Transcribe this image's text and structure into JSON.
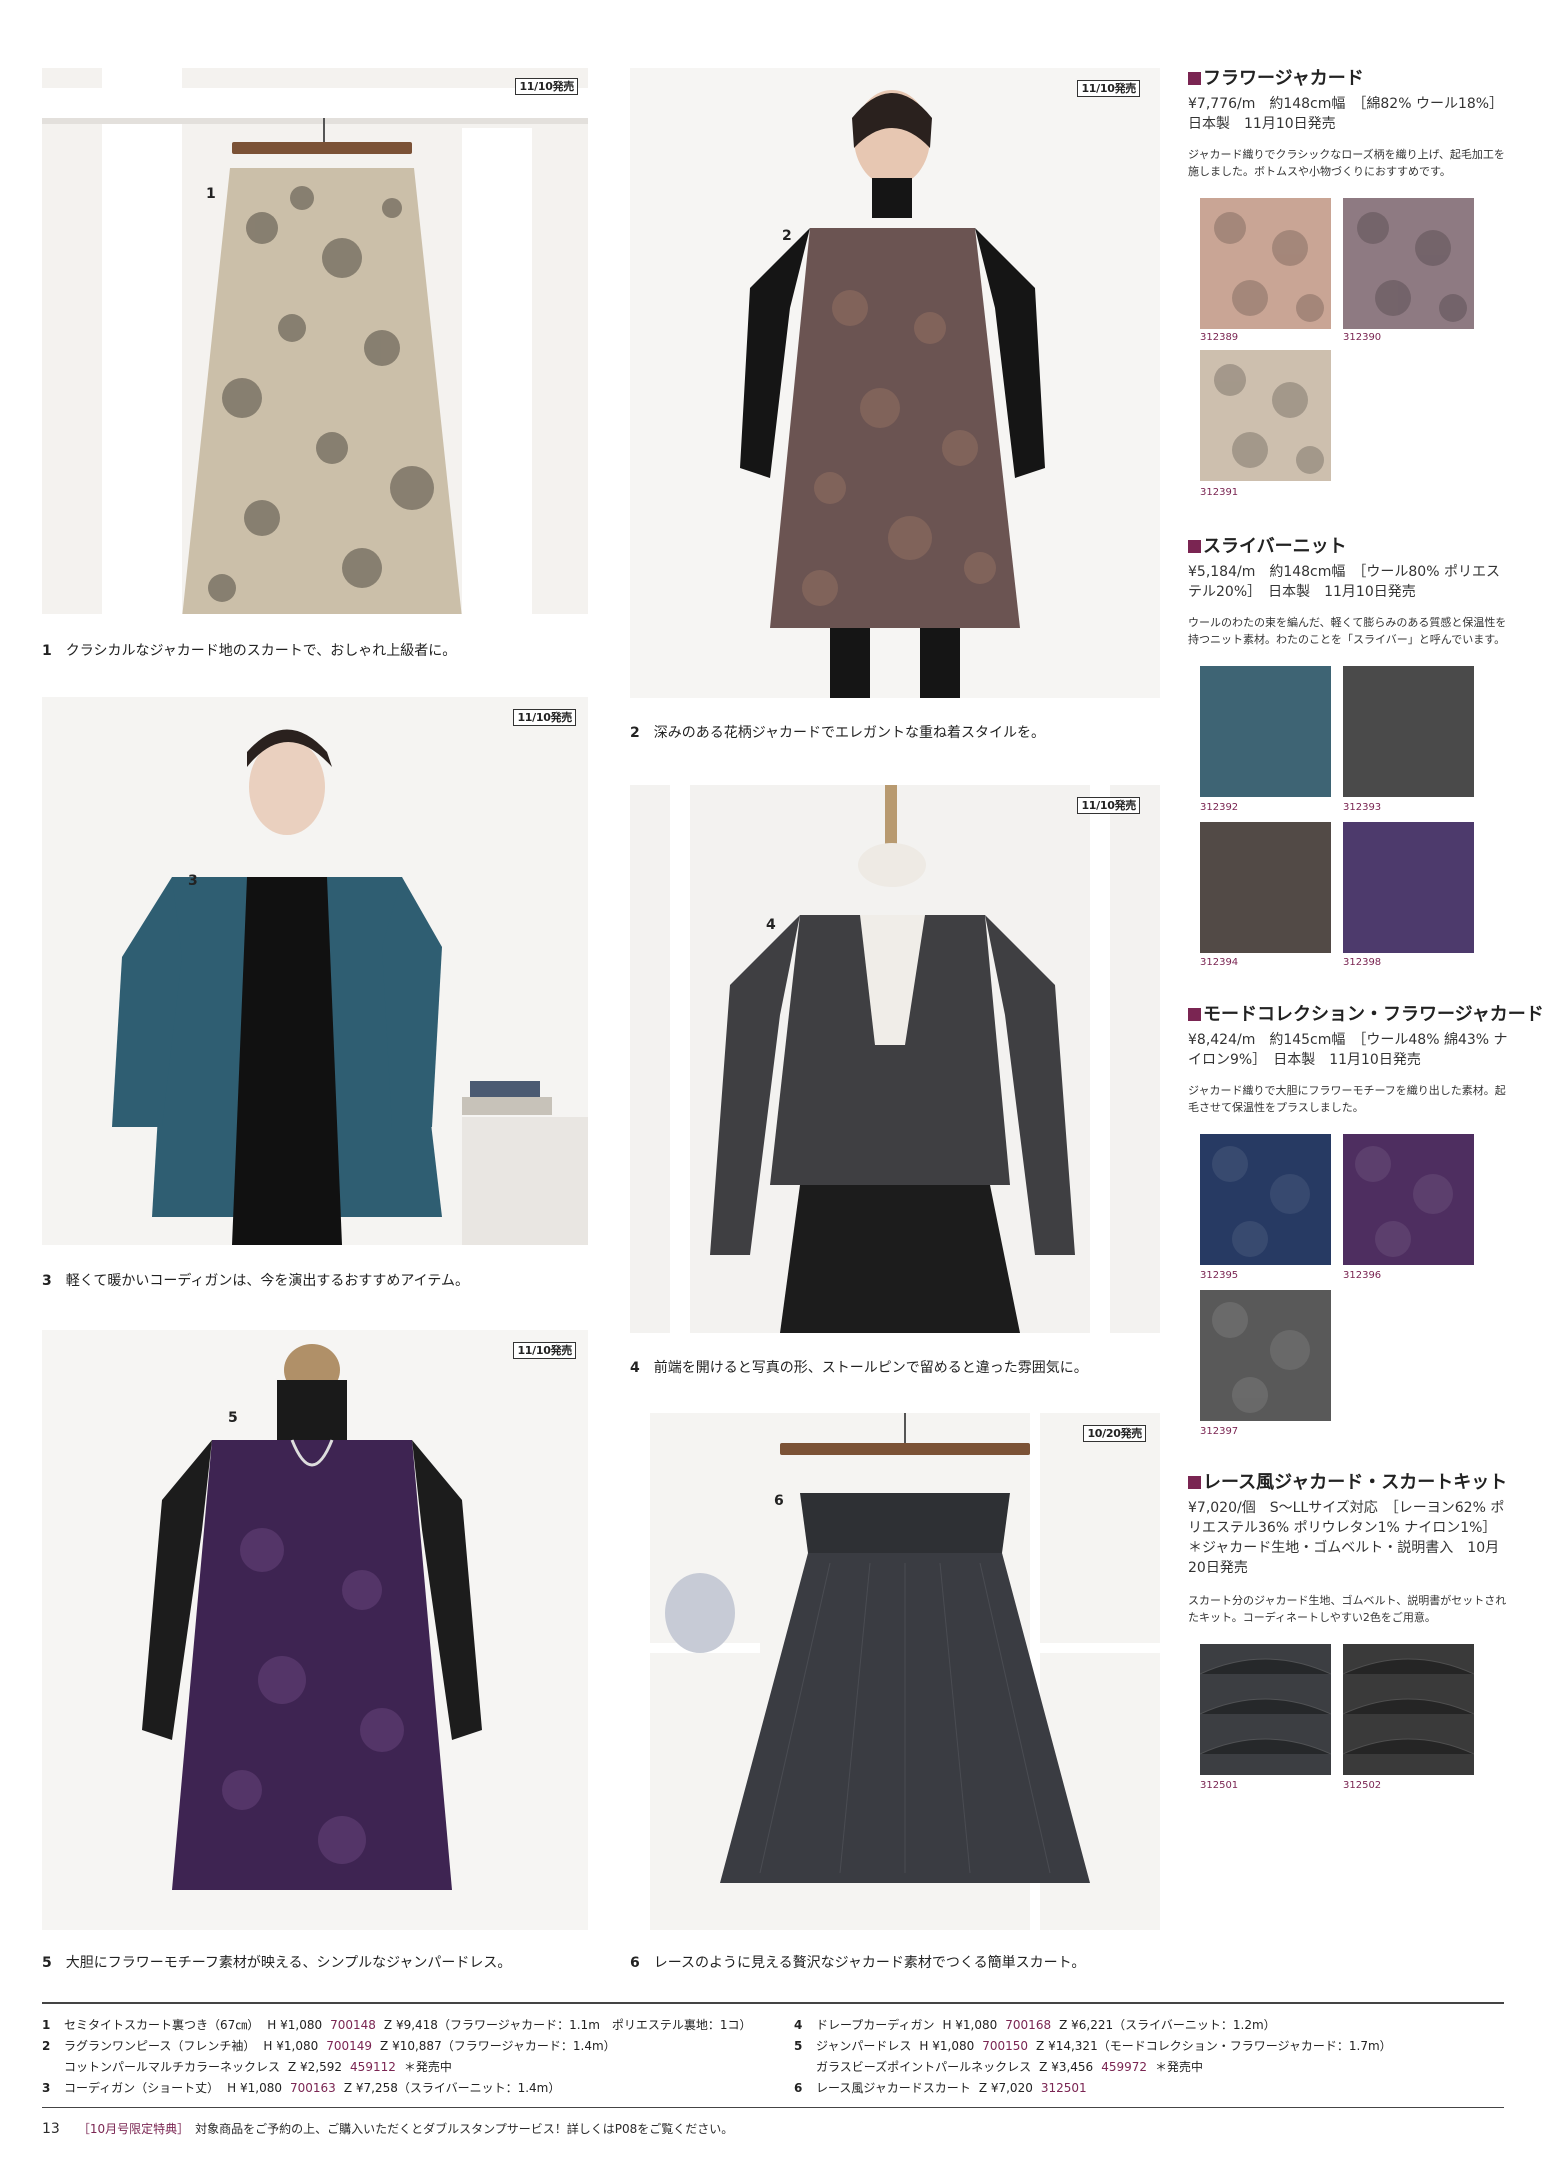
{
  "photos": [
    {
      "tag": "11/10発売",
      "num": "1",
      "caption_num": "1",
      "caption": "クラシカルなジャカード地のスカートで、おしゃれ上級者に。"
    },
    {
      "tag": "11/10発売",
      "num": "2",
      "caption_num": "2",
      "caption": "深みのある花柄ジャカードでエレガントな重ね着スタイルを。"
    },
    {
      "tag": "11/10発売",
      "num": "3",
      "caption_num": "3",
      "caption": "軽くて暖かいコーディガンは、今を演出するおすすめアイテム。"
    },
    {
      "tag": "11/10発売",
      "num": "4",
      "caption_num": "4",
      "caption": "前端を開けると写真の形、ストールピンで留めると違った雰囲気に。"
    },
    {
      "tag": "11/10発売",
      "num": "5",
      "caption_num": "5",
      "caption": "大胆にフラワーモチーフ素材が映える、シンプルなジャンパードレス。"
    },
    {
      "tag": "10/20発売",
      "num": "6",
      "caption_num": "6",
      "caption": "レースのように見える贅沢なジャカード素材でつくる簡単スカート。"
    }
  ],
  "sections": [
    {
      "title": "フラワージャカード",
      "info": "¥7,776/m　約148cm幅　［綿82% ウール18%］日本製　11月10日発売",
      "desc": "ジャカード織りでクラシックなローズ柄を織り上げ、起毛加工を施しました。ボトムスや小物づくりにおすすめです。",
      "swatches": [
        {
          "code": "312389",
          "color": "#c9a595"
        },
        {
          "code": "312390",
          "color": "#8e7a82"
        },
        {
          "code": "312391",
          "color": "#cdbfae"
        }
      ]
    },
    {
      "title": "スライバーニット",
      "info": "¥5,184/m　約148cm幅　［ウール80% ポリエステル20%］　日本製　11月10日発売",
      "desc": "ウールのわたの束を編んだ、軽くて膨らみのある質感と保温性を持つニット素材。わたのことを「スライバー」と呼んでいます。",
      "swatches": [
        {
          "code": "312392",
          "color": "#3e6474"
        },
        {
          "code": "312393",
          "color": "#4a4a4a"
        },
        {
          "code": "312394",
          "color": "#524a46"
        },
        {
          "code": "312398",
          "color": "#4d3a6c"
        }
      ]
    },
    {
      "title": "モードコレクション・フラワージャカード",
      "info": "¥8,424/m　約145cm幅　［ウール48% 綿43% ナイロン9%］　日本製　11月10日発売",
      "desc": "ジャカード織りで大胆にフラワーモチーフを織り出した素材。起毛させて保温性をプラスしました。",
      "swatches": [
        {
          "code": "312395",
          "color": "#273a63"
        },
        {
          "code": "312396",
          "color": "#4e2e60"
        },
        {
          "code": "312397",
          "color": "#595959"
        }
      ]
    },
    {
      "title": "レース風ジャカード・スカートキット",
      "info": "¥7,020/個　S～LLサイズ対応　［レーヨン62% ポリエステル36% ポリウレタン1% ナイロン1%］＊ジャカード生地・ゴムベルト・説明書入　10月20日発売",
      "desc": "スカート分のジャカード生地、ゴムベルト、説明書がセットされたキット。コーディネートしやすい2色をご用意。",
      "swatches": [
        {
          "code": "312501",
          "color": "#3c3e42"
        },
        {
          "code": "312502",
          "color": "#3a3a3a"
        }
      ]
    }
  ],
  "footer_left": [
    {
      "n": "1",
      "item": "セミタイトスカート裏つき（67㎝）",
      "h": "H ¥1,080",
      "hcode": "700148",
      "z": "Z ¥9,418（フラワージャカード：1.1m　ポリエステル裏地：1コ）",
      "zcode": "",
      "extra": ""
    },
    {
      "n": "2",
      "item": "ラグランワンピース（フレンチ袖）",
      "h": "H ¥1,080",
      "hcode": "700149",
      "z": "Z ¥10,887（フラワージャカード：1.4m）",
      "zcode": "",
      "extra": ""
    },
    {
      "n": "",
      "item": "コットンパールマルチカラーネックレス",
      "h": "",
      "hcode": "",
      "z": "Z ¥2,592",
      "zcode": "459112",
      "extra": "＊発売中"
    },
    {
      "n": "3",
      "item": "コーディガン（ショート丈）",
      "h": "H ¥1,080",
      "hcode": "700163",
      "z": "Z ¥7,258（スライバーニット：1.4m）",
      "zcode": "",
      "extra": ""
    }
  ],
  "footer_right": [
    {
      "n": "4",
      "item": "ドレープカーディガン",
      "h": "H ¥1,080",
      "hcode": "700168",
      "z": "Z ¥6,221（スライバーニット：1.2m）",
      "zcode": "",
      "extra": ""
    },
    {
      "n": "5",
      "item": "ジャンパードレス",
      "h": "H ¥1,080",
      "hcode": "700150",
      "z": "Z ¥14,321（モードコレクション・フラワージャカード：1.7m）",
      "zcode": "",
      "extra": ""
    },
    {
      "n": "",
      "item": "ガラスビーズポイントパールネックレス",
      "h": "",
      "hcode": "",
      "z": "Z ¥3,456",
      "zcode": "459972",
      "extra": "＊発売中"
    },
    {
      "n": "6",
      "item": "レース風ジャカードスカート",
      "h": "",
      "hcode": "",
      "z": "Z ¥7,020",
      "zcode": "312501",
      "extra": ""
    }
  ],
  "footer": {
    "page_number": "13",
    "special": "［10月号限定特典］",
    "text": "対象商品をご予約の上、ご購入いただくとダブルスタンプサービス！詳しくはP08をご覧ください。"
  }
}
